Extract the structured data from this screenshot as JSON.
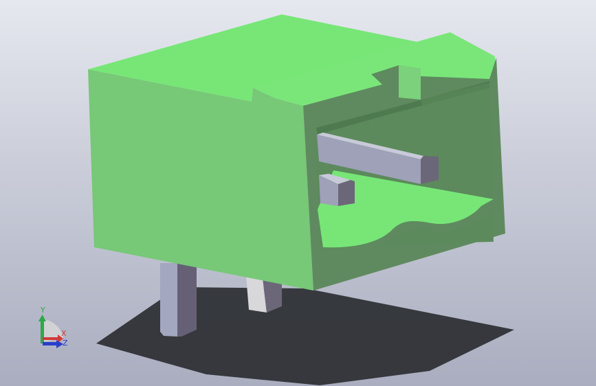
{
  "viewport": {
    "background_top": "#e6e8ef",
    "background_bottom": "#a9adbf"
  },
  "model": {
    "body_color": "#77c877",
    "top_color": "#77e677",
    "dark_side_color": "#5f8a5f",
    "pin_color": "#9ea1b8",
    "shadow_color": "#2f3136"
  },
  "triad": {
    "x_label": "X",
    "y_label": "Y",
    "z_label": "Z",
    "x_color": "#d23a3a",
    "y_color": "#2fa84a",
    "z_color": "#2b3ec9"
  }
}
